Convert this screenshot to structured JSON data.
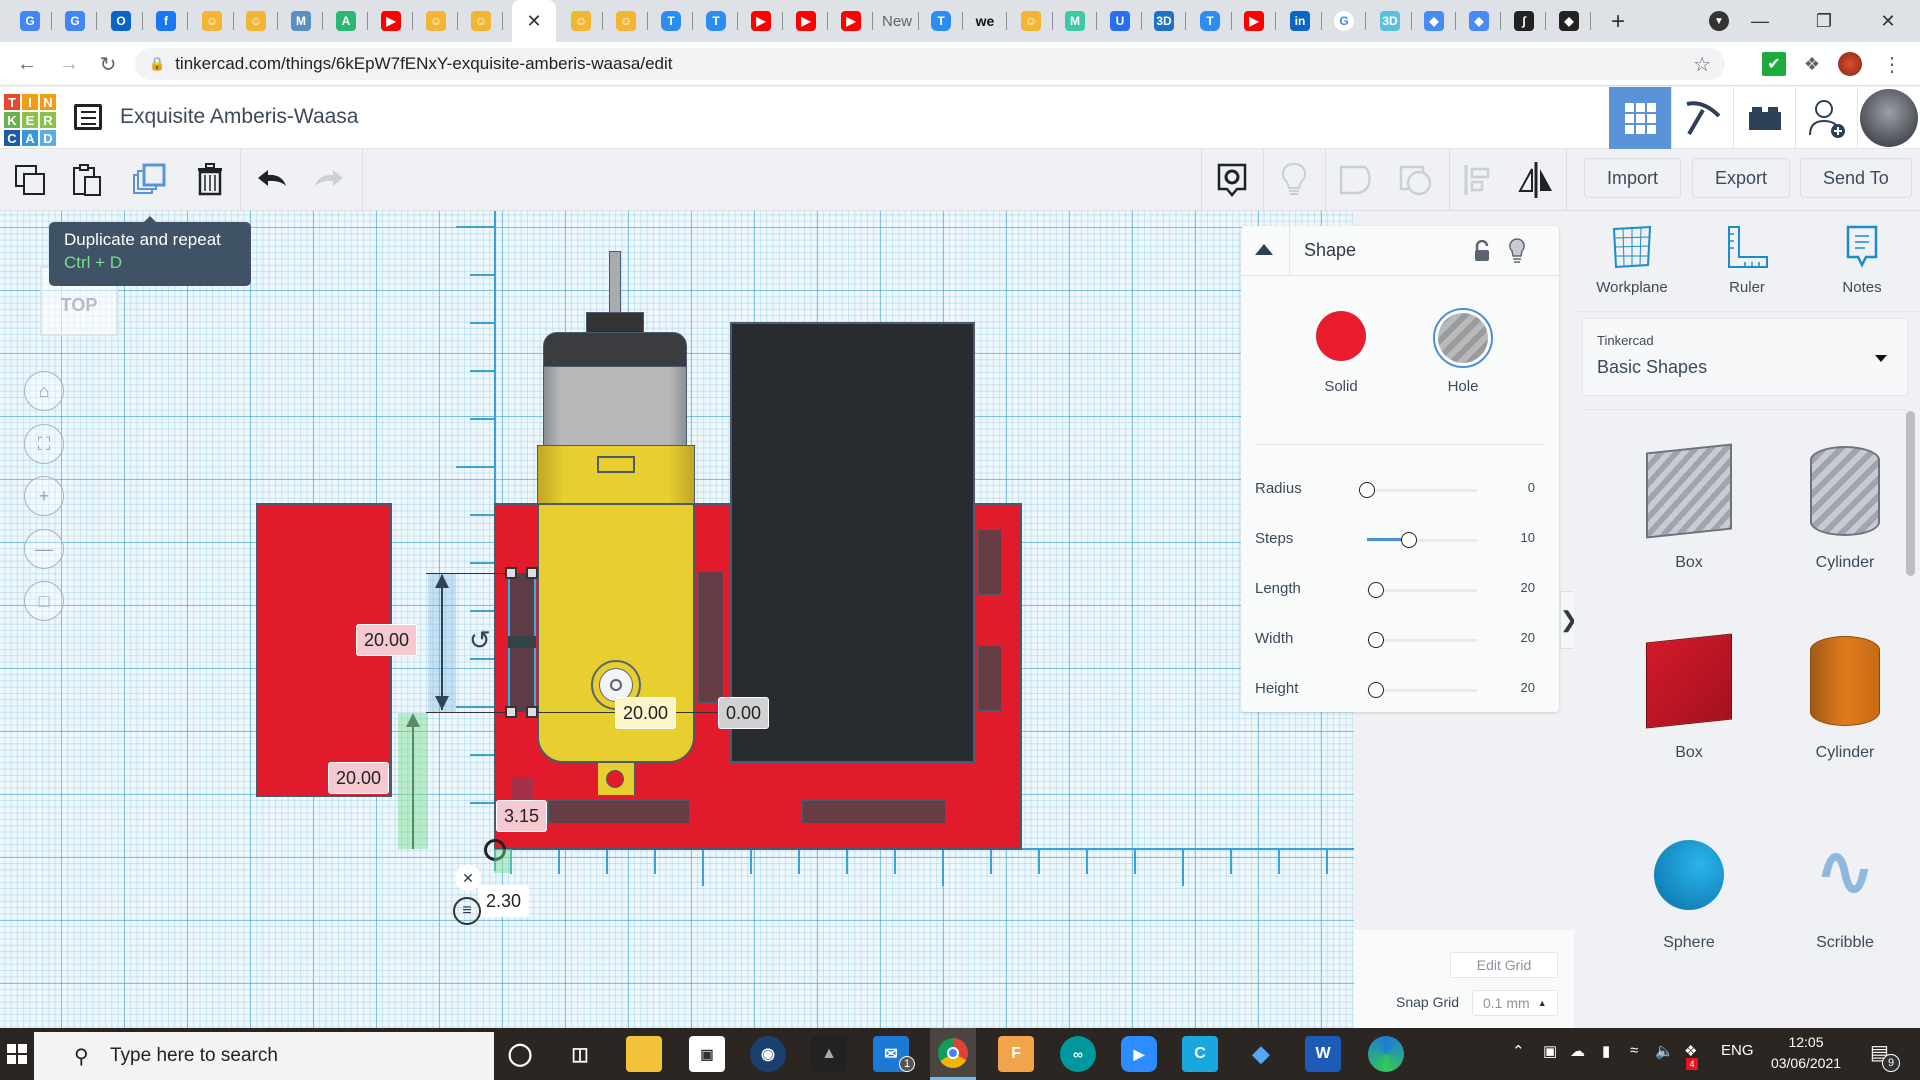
{
  "browser": {
    "tabs": [
      {
        "icon": "google-translate-icon",
        "color": "#4285f4",
        "glyph": "G"
      },
      {
        "icon": "google-translate-icon",
        "color": "#4285f4",
        "glyph": "G"
      },
      {
        "icon": "outlook-icon",
        "color": "#0a64c8",
        "glyph": "O"
      },
      {
        "icon": "facebook-icon",
        "color": "#1877f2",
        "glyph": "f"
      },
      {
        "icon": "tinkercad-robot-icon",
        "color": "#f2b632",
        "glyph": "☺"
      },
      {
        "icon": "tinkercad-robot-icon",
        "color": "#f2b632",
        "glyph": "☺"
      },
      {
        "icon": "hexagon-m-icon",
        "color": "#5b8fbf",
        "glyph": "M"
      },
      {
        "icon": "autodesk-icon",
        "color": "#2bb673",
        "glyph": "A"
      },
      {
        "icon": "youtube-icon",
        "color": "#ff0000",
        "glyph": "▶"
      },
      {
        "icon": "tinkercad-robot-icon",
        "color": "#f2b632",
        "glyph": "☺"
      },
      {
        "icon": "tinkercad-robot-icon",
        "color": "#f2b632",
        "glyph": "☺"
      },
      {
        "icon": "active-tab-close-icon",
        "active": true,
        "glyph": "✕"
      },
      {
        "icon": "tinkercad-robot-icon",
        "color": "#f2b632",
        "glyph": "☺"
      },
      {
        "icon": "tinkercad-robot-icon",
        "color": "#f2b632",
        "glyph": "☺"
      },
      {
        "icon": "t-circle-icon",
        "color": "#2d8cf0",
        "glyph": "T"
      },
      {
        "icon": "t-circle-icon",
        "color": "#2d8cf0",
        "glyph": "T"
      },
      {
        "icon": "youtube-icon",
        "color": "#ff0000",
        "glyph": "▶"
      },
      {
        "icon": "youtube-icon",
        "color": "#ff0000",
        "glyph": "▶"
      },
      {
        "icon": "youtube-icon",
        "color": "#ff0000",
        "glyph": "▶"
      },
      {
        "icon": "new-tab-text",
        "color": "",
        "glyph": "New",
        "text": true
      },
      {
        "icon": "t-circle-icon",
        "color": "#2d8cf0",
        "glyph": "T"
      },
      {
        "icon": "we-icon",
        "color": "",
        "glyph": "we",
        "text": true
      },
      {
        "icon": "tinkercad-robot-icon",
        "color": "#f2b632",
        "glyph": "☺"
      },
      {
        "icon": "m-icon",
        "color": "#3dc9a4",
        "glyph": "M"
      },
      {
        "icon": "u-icon",
        "color": "#2a6ef0",
        "glyph": "U"
      },
      {
        "icon": "3d-icon",
        "color": "#1a73c9",
        "glyph": "3D"
      },
      {
        "icon": "t-circle-icon",
        "color": "#2d8cf0",
        "glyph": "T"
      },
      {
        "icon": "youtube-icon",
        "color": "#ff0000",
        "glyph": "▶"
      },
      {
        "icon": "linkedin-icon",
        "color": "#0a66c2",
        "glyph": "in"
      },
      {
        "icon": "google-icon",
        "color": "#ffffff",
        "glyph": "G",
        "dark": true
      },
      {
        "icon": "robot-3d-icon",
        "color": "#5bc0de",
        "glyph": "3D"
      },
      {
        "icon": "book-icon",
        "color": "#4a8af4",
        "glyph": "◆"
      },
      {
        "icon": "book-icon",
        "color": "#4a8af4",
        "glyph": "◆"
      },
      {
        "icon": "integral-icon",
        "color": "#222222",
        "glyph": "∫"
      },
      {
        "icon": "inkscape-icon",
        "color": "#222222",
        "glyph": "◆"
      }
    ],
    "new_tab_glyph": "+",
    "url": "tinkercad.com/things/6kEpW7fENxY-exquisite-amberis-waasa/edit"
  },
  "app": {
    "logo_letters": [
      "T",
      "I",
      "N",
      "K",
      "E",
      "R",
      "C",
      "A",
      "D"
    ],
    "logo_colors": [
      "#e8492d",
      "#f39c12",
      "#f39c12",
      "#6ab04c",
      "#8bc34a",
      "#8bc34a",
      "#1e5aa8",
      "#3498db",
      "#5dade2"
    ],
    "title": "Exquisite Amberis-Waasa"
  },
  "toolbar": {
    "import_label": "Import",
    "export_label": "Export",
    "sendto_label": "Send To",
    "tooltip_title": "Duplicate and repeat",
    "tooltip_shortcut": "Ctrl + D"
  },
  "viewcube_label": "TOP",
  "dimensions": {
    "left_height": "20.00",
    "left_bottom": "20.00",
    "right_width": "20.00",
    "offset_right": "0.00",
    "bottom_offset": "3.15",
    "x_offset": "2.30"
  },
  "inspector": {
    "title": "Shape",
    "solid_label": "Solid",
    "hole_label": "Hole",
    "solid_color": "#e81c2c",
    "properties": [
      {
        "label": "Radius",
        "value": "0",
        "fraction": 0.0
      },
      {
        "label": "Steps",
        "value": "10",
        "fraction": 0.38
      },
      {
        "label": "Length",
        "value": "20",
        "fraction": 0.08
      },
      {
        "label": "Width",
        "value": "20",
        "fraction": 0.08
      },
      {
        "label": "Height",
        "value": "20",
        "fraction": 0.08
      }
    ]
  },
  "right_panel": {
    "tools": [
      {
        "label": "Workplane"
      },
      {
        "label": "Ruler"
      },
      {
        "label": "Notes"
      }
    ],
    "library_category": "Tinkercad",
    "library_name": "Basic Shapes",
    "shapes": [
      {
        "label": "Box",
        "kind": "hole-box"
      },
      {
        "label": "Cylinder",
        "kind": "hole-cylinder"
      },
      {
        "label": "Box",
        "kind": "box"
      },
      {
        "label": "Cylinder",
        "kind": "cylinder"
      },
      {
        "label": "Sphere",
        "kind": "sphere"
      },
      {
        "label": "Scribble",
        "kind": "scribble"
      }
    ]
  },
  "grid": {
    "edit_grid_label": "Edit Grid",
    "snap_grid_label": "Snap Grid",
    "snap_value": "0.1 mm"
  },
  "taskbar": {
    "search_placeholder": "Type here to search",
    "language": "ENG",
    "time": "12:05",
    "date": "03/06/2021",
    "notification_count": "9",
    "mail_badge": "1",
    "dropbox_badge": "4"
  }
}
